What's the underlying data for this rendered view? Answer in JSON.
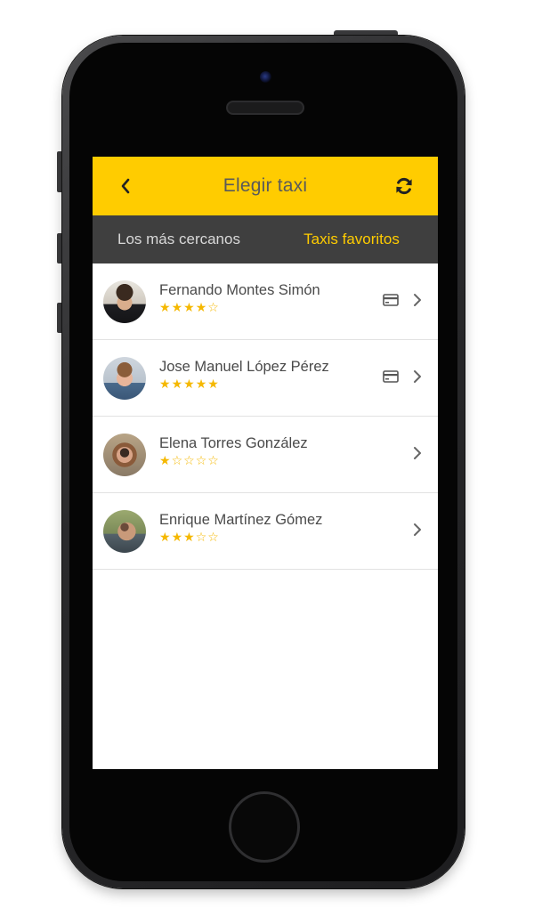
{
  "header": {
    "title": "Elegir taxi",
    "back_icon": "chevron-left-icon",
    "refresh_icon": "refresh-icon"
  },
  "tabs": [
    {
      "label": "Los más cercanos",
      "active": false
    },
    {
      "label": "Taxis favoritos",
      "active": true
    }
  ],
  "drivers": [
    {
      "name": "Fernando Montes Simón",
      "rating": 4,
      "max_rating": 5,
      "card_payment": true
    },
    {
      "name": "Jose Manuel López Pérez",
      "rating": 5,
      "max_rating": 5,
      "card_payment": true
    },
    {
      "name": "Elena Torres González",
      "rating": 1,
      "max_rating": 5,
      "card_payment": false
    },
    {
      "name": "Enrique Martínez Gómez",
      "rating": 3,
      "max_rating": 5,
      "card_payment": false
    }
  ],
  "colors": {
    "accent": "#ffcc00",
    "tabbar": "#3f3f3f",
    "star": "#f5b800"
  }
}
